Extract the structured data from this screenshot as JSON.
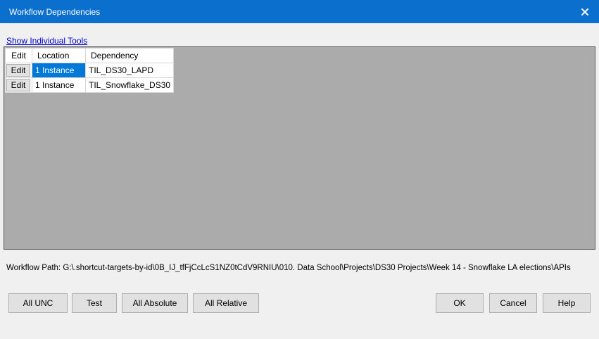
{
  "window": {
    "title": "Workflow Dependencies"
  },
  "link": {
    "show_individual_tools": "Show Individual Tools"
  },
  "table": {
    "headers": {
      "edit": "Edit",
      "location": "Location",
      "dependency": "Dependency"
    },
    "rows": [
      {
        "edit": "Edit",
        "location": "1 Instance",
        "dependency": "TIL_DS30_LAPD",
        "selected": true
      },
      {
        "edit": "Edit",
        "location": "1 Instance",
        "dependency": "TIL_Snowflake_DS30",
        "selected": false
      }
    ]
  },
  "path": {
    "label": "Workflow Path:",
    "value": "G:\\.shortcut-targets-by-id\\0B_IJ_tfFjCcLcS1NZ0tCdV9RNIU\\010. Data School\\Projects\\DS30 Projects\\Week 14 - Snowflake LA elections\\APIs"
  },
  "buttons": {
    "all_unc": "All UNC",
    "test": "Test",
    "all_absolute": "All Absolute",
    "all_relative": "All Relative",
    "ok": "OK",
    "cancel": "Cancel",
    "help": "Help"
  },
  "icons": {
    "close": "close-icon"
  },
  "colors": {
    "titlebar": "#0b6fce",
    "selection": "#0078d7",
    "grid_background": "#ababab"
  }
}
